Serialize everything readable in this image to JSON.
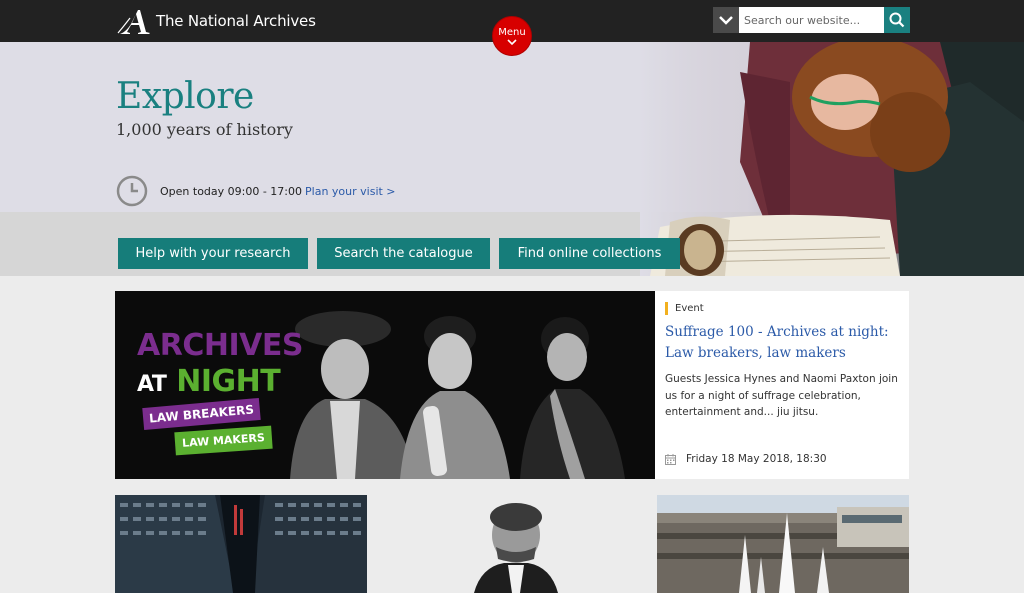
{
  "header": {
    "logo_text": "The National Archives",
    "menu_label": "Menu",
    "search_placeholder": "Search our website..."
  },
  "hero": {
    "title": "Explore",
    "subtitle": "1,000 years of history",
    "hours_text": "Open today 09:00 - 17:00",
    "plan_link": "Plan your visit >",
    "buttons": [
      {
        "label": "Help with your research"
      },
      {
        "label": "Search the catalogue"
      },
      {
        "label": "Find online collections"
      }
    ]
  },
  "feature": {
    "image_text": {
      "line1": "ARCHIVES",
      "line2a": "AT",
      "line2b": "NIGHT",
      "banner1": "LAW BREAKERS",
      "banner2": "LAW MAKERS"
    },
    "tag": "Event",
    "title": "Suffrage 100 - Archives at night: Law breakers, law makers",
    "description": "Guests Jessica Hynes and Naomi Paxton join us for a night of suffrage celebration, entertainment and... jiu jitsu.",
    "date": "Friday 18 May 2018, 18:30"
  },
  "colors": {
    "teal": "#1a8080",
    "menu_red": "#d70000",
    "link_blue": "#2b5aa8",
    "event_yellow": "#f2b01e"
  }
}
